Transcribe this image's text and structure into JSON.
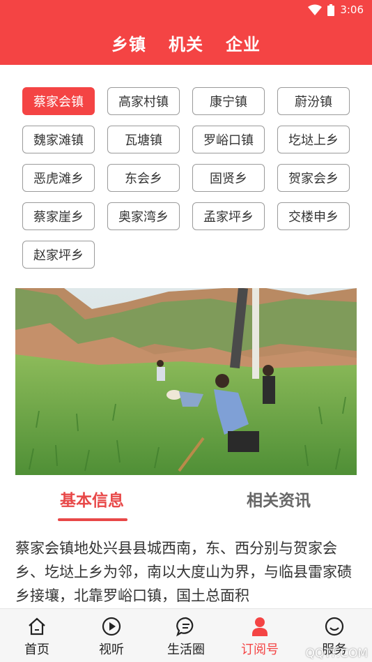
{
  "status": {
    "time": "3:06",
    "icons": [
      "wifi-icon",
      "battery-icon"
    ]
  },
  "header": {
    "tabs": [
      "乡镇",
      "机关",
      "企业"
    ]
  },
  "towns": [
    "蔡家会镇",
    "高家村镇",
    "康宁镇",
    "蔚汾镇",
    "魏家滩镇",
    "瓦塘镇",
    "罗峪口镇",
    "圪垯上乡",
    "恶虎滩乡",
    "东会乡",
    "固贤乡",
    "贺家会乡",
    "蔡家崖乡",
    "奥家湾乡",
    "孟家坪乡",
    "交楼申乡",
    "赵家坪乡"
  ],
  "selected_town": "蔡家会镇",
  "subtabs": {
    "basic": "基本信息",
    "news": "相关资讯"
  },
  "description": "蔡家会镇地处兴县县城西南，东、西分别与贺家会乡、圪垯上乡为邻，南以大度山为界，与临县雷家碛乡接壤，北靠罗峪口镇，国土总面积",
  "bottom_nav": [
    {
      "label": "首页",
      "icon": "home-icon"
    },
    {
      "label": "视听",
      "icon": "play-icon"
    },
    {
      "label": "生活圈",
      "icon": "chat-icon"
    },
    {
      "label": "订阅号",
      "icon": "subscription-icon"
    },
    {
      "label": "服务",
      "icon": "service-icon"
    }
  ],
  "active_nav": "订阅号",
  "watermark": "QQTF.COM",
  "colors": {
    "brand_red": "#f44444",
    "text_dark": "#333333",
    "tab_inactive": "#666666"
  }
}
